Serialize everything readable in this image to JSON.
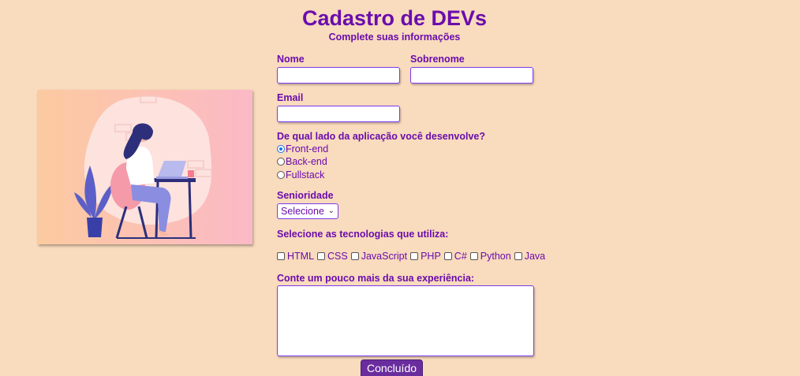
{
  "header": {
    "title": "Cadastro de DEVs",
    "subtitle": "Complete suas informações"
  },
  "form": {
    "nome_label": "Nome",
    "nome_value": "",
    "sobrenome_label": "Sobrenome",
    "sobrenome_value": "",
    "email_label": "Email",
    "email_value": "",
    "lado_label": "De qual lado da aplicação você desenvolve?",
    "lado_options": [
      {
        "label": "Front-end",
        "checked": true
      },
      {
        "label": "Back-end",
        "checked": false
      },
      {
        "label": "Fullstack",
        "checked": false
      }
    ],
    "senioridade_label": "Senioridade",
    "senioridade_selected": "Selecione",
    "tecnologias_label": "Selecione as tecnologias que utiliza:",
    "tecnologias": [
      {
        "label": "HTML",
        "checked": false
      },
      {
        "label": "CSS",
        "checked": false
      },
      {
        "label": "JavaScript",
        "checked": false
      },
      {
        "label": "PHP",
        "checked": false
      },
      {
        "label": "C#",
        "checked": false
      },
      {
        "label": "Python",
        "checked": false
      },
      {
        "label": "Java",
        "checked": false
      }
    ],
    "experiencia_label": "Conte um pouco mais da sua experiência:",
    "experiencia_value": "",
    "submit_label": "Concluído"
  },
  "illustration": {
    "icon": "woman-working-on-laptop-illustration"
  },
  "colors": {
    "background": "#f9dbbd",
    "text": "#6a0dad",
    "button": "#6a2d9e"
  }
}
